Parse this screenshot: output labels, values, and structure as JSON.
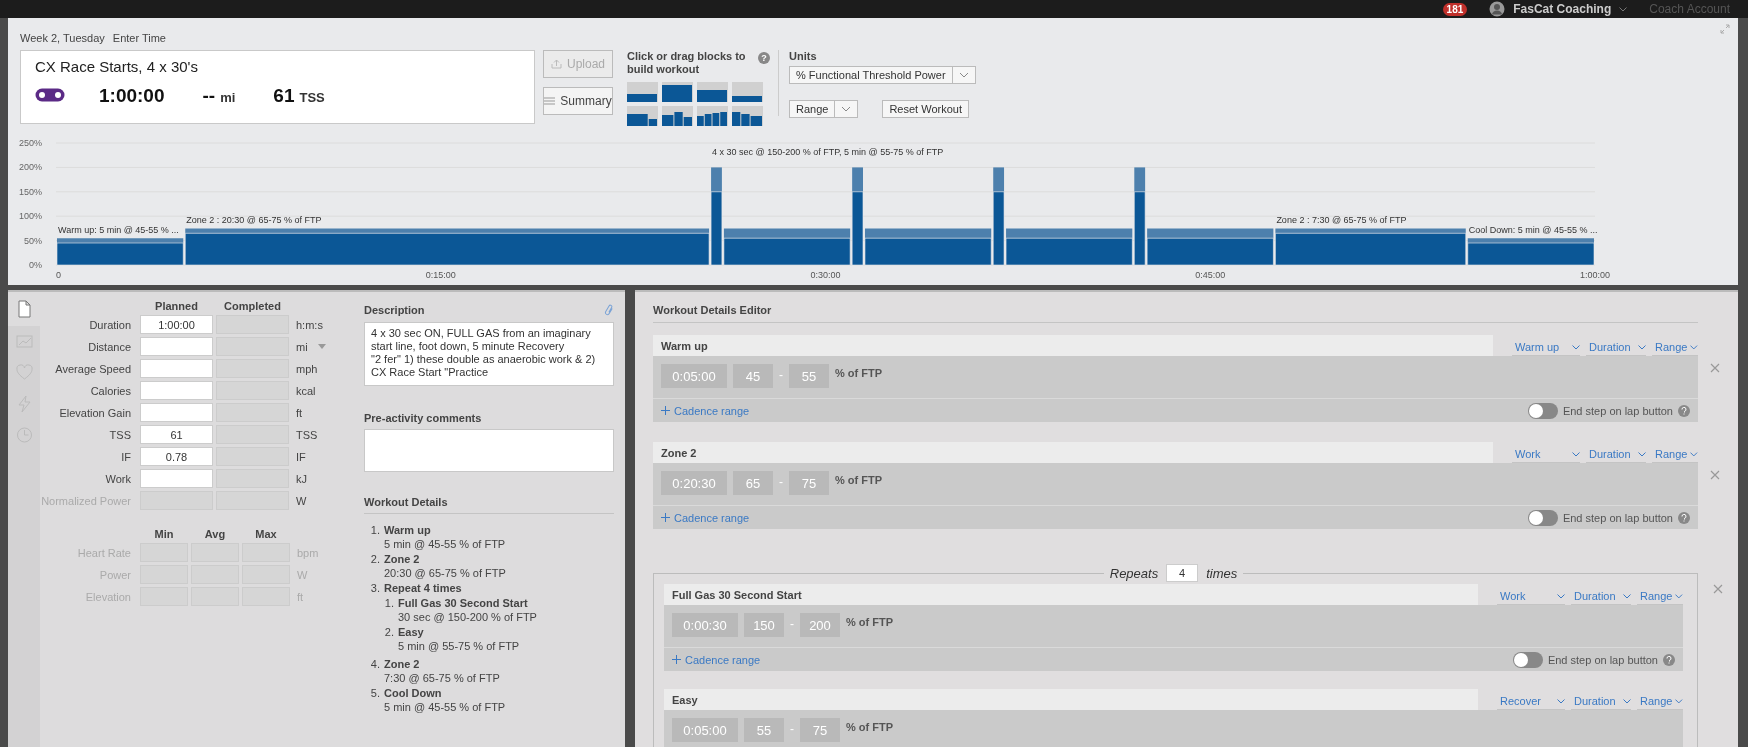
{
  "top_bar": {
    "notifications": "181",
    "user": "FasCat Coaching",
    "account": "Coach Account"
  },
  "header": {
    "date": "Week 2, Tuesday",
    "enter_time": "Enter Time",
    "title": "CX Race Starts, 4 x 30's",
    "duration": "1:00:00",
    "distance": "--",
    "distance_unit": "mi",
    "tss": "61",
    "tss_unit": "TSS",
    "upload": {
      "label": "Upload",
      "disabled": true
    },
    "summary": {
      "label": "Summary",
      "disabled": false
    }
  },
  "palette": {
    "title": "Click or drag blocks to build workout",
    "help": "?"
  },
  "units": {
    "label": "Units",
    "select": "% Functional Threshold Power",
    "range": "Range",
    "reset": "Reset Workout"
  },
  "chart": {
    "chart_data": {
      "type": "area",
      "stacked": false,
      "x": [
        0,
        5,
        5,
        25.5,
        25.5,
        26,
        26,
        31,
        31,
        31.5,
        31.5,
        36.5,
        36.5,
        37,
        37,
        42,
        42,
        42.5,
        42.5,
        47.5,
        47.5,
        55,
        55,
        60
      ],
      "grid": true,
      "series": [
        {
          "color": "#0b5796",
          "values": [
            45,
            45,
            65,
            65,
            150,
            150,
            55,
            55,
            150,
            150,
            55,
            55,
            150,
            150,
            55,
            55,
            150,
            150,
            55,
            55,
            65,
            65,
            45,
            45
          ]
        },
        {
          "color": "#4d80ad",
          "values": [
            55,
            55,
            75,
            75,
            200,
            200,
            75,
            75,
            200,
            200,
            75,
            75,
            200,
            200,
            75,
            75,
            200,
            200,
            75,
            75,
            75,
            75,
            55,
            55
          ]
        }
      ],
      "xlim": [
        0,
        60
      ],
      "ylim": [
        0,
        250
      ],
      "xticks": [
        {
          "value": 0,
          "label": "0"
        },
        {
          "value": 15,
          "label": "0:15:00"
        },
        {
          "value": 30,
          "label": "0:30:00"
        },
        {
          "value": 45,
          "label": "0:45:00"
        },
        {
          "value": 60,
          "label": "1:00:00"
        }
      ],
      "yticks": [
        {
          "value": 0,
          "label": "0%"
        },
        {
          "value": 50,
          "label": "50%"
        },
        {
          "value": 100,
          "label": "100%"
        },
        {
          "value": 150,
          "label": "150%"
        },
        {
          "value": 200,
          "label": "200%"
        },
        {
          "value": 250,
          "label": "250%"
        }
      ],
      "annotations": [
        "Warm up: 5 min @ 45-55 % ...",
        "Zone 2 : 20:30 @ 65-75 % of FTP",
        "4 x 30 sec @ 150-200 % of FTP, 5 min @ 55-75 % of FTP",
        "Zone 2 : 7:30 @ 65-75 % of FTP",
        "Cool Down: 5 min @ 45-55 % ..."
      ]
    }
  },
  "sidebar_tabs": [
    {
      "selected": true
    },
    {
      "selected": false
    },
    {
      "selected": false
    },
    {
      "selected": false
    },
    {
      "selected": false
    }
  ],
  "summary_table": {
    "columns": [
      "Planned",
      "Completed"
    ],
    "rows": [
      {
        "kind": "text",
        "label": "Duration",
        "planned": "1:00:00",
        "unit": "h:m:s",
        "disabled": false
      },
      {
        "kind": "select",
        "label": "Distance",
        "unit": "mi",
        "disabled": false
      },
      {
        "kind": "text",
        "label": "Average Speed",
        "unit": "mph",
        "disabled": false
      },
      {
        "kind": "text",
        "label": "Calories",
        "unit": "kcal",
        "disabled": false
      },
      {
        "kind": "text",
        "label": "Elevation Gain",
        "unit": "ft",
        "disabled": false
      },
      {
        "kind": "text",
        "label": "TSS",
        "planned": "61",
        "unit": "TSS",
        "disabled": false
      },
      {
        "kind": "text",
        "label": "IF",
        "planned": "0.78",
        "unit": "IF",
        "disabled": false
      },
      {
        "kind": "text",
        "label": "Work",
        "unit": "kJ",
        "disabled": false
      },
      {
        "kind": "text",
        "label": "Normalized Power",
        "unit": "W",
        "disabled": true
      }
    ]
  },
  "range_table": {
    "columns": [
      "Min",
      "Avg",
      "Max"
    ],
    "rows": [
      {
        "label": "Heart Rate",
        "unit": "bpm",
        "disabled": true
      },
      {
        "label": "Power",
        "unit": "W",
        "disabled": true
      },
      {
        "label": "Elevation",
        "unit": "ft",
        "disabled": true
      }
    ]
  },
  "description": {
    "title": "Description",
    "text": "4 x 30 sec ON, FULL GAS from an imaginary start line, foot down, 5 minute Recovery\n\"2 fer\" 1) these double as anaerobic work & 2) CX Race Start \"Practice"
  },
  "comments": {
    "title": "Pre-activity comments"
  },
  "workout_details": {
    "title": "Workout Details",
    "items": [
      {
        "num": "1.",
        "name": "Warm up",
        "detail": "5 min @ 45-55 % of FTP"
      },
      {
        "num": "2.",
        "name": "Zone 2",
        "detail": "20:30 @ 65-75 % of FTP"
      },
      {
        "num": "3.",
        "name": "Repeat 4 times",
        "children": [
          {
            "num": "1.",
            "name": "Full Gas 30 Second Start",
            "detail": "30 sec @ 150-200 % of FTP"
          },
          {
            "num": "2.",
            "name": "Easy",
            "detail": "5 min @ 55-75 % of FTP"
          }
        ]
      },
      {
        "num": "4.",
        "name": "Zone 2",
        "detail": "7:30 @ 65-75 % of FTP"
      },
      {
        "num": "5.",
        "name": "Cool Down",
        "detail": "5 min @ 45-55 % of FTP"
      }
    ]
  },
  "editor": {
    "title": "Workout Details Editor",
    "steps": [
      {
        "kind": "step",
        "name": "Warm up",
        "type": "Warm up",
        "length": "Duration",
        "target": "Range",
        "duration": "0:05:00",
        "low": "45",
        "dash": "-",
        "high": "55",
        "unit": "% of FTP",
        "cadence": "Cadence range",
        "lap_on": false,
        "lap_label": "End step on lap button"
      },
      {
        "kind": "step",
        "name": "Zone 2",
        "type": "Work",
        "length": "Duration",
        "target": "Range",
        "duration": "0:20:30",
        "low": "65",
        "dash": "-",
        "high": "75",
        "unit": "% of FTP",
        "cadence": "Cadence range",
        "lap_on": false,
        "lap_label": "End step on lap button"
      },
      {
        "kind": "repeat",
        "label": "Repeats",
        "count": "4",
        "suffix": "times",
        "children": [
          {
            "kind": "step",
            "name": "Full Gas 30 Second Start",
            "type": "Work",
            "length": "Duration",
            "target": "Range",
            "duration": "0:00:30",
            "low": "150",
            "dash": "-",
            "high": "200",
            "unit": "% of FTP",
            "cadence": "Cadence range",
            "lap_on": false,
            "lap_label": "End step on lap button"
          },
          {
            "kind": "step",
            "name": "Easy",
            "type": "Recover",
            "length": "Duration",
            "target": "Range",
            "duration": "0:05:00",
            "low": "55",
            "dash": "-",
            "high": "75",
            "unit": "% of FTP"
          }
        ]
      }
    ]
  }
}
